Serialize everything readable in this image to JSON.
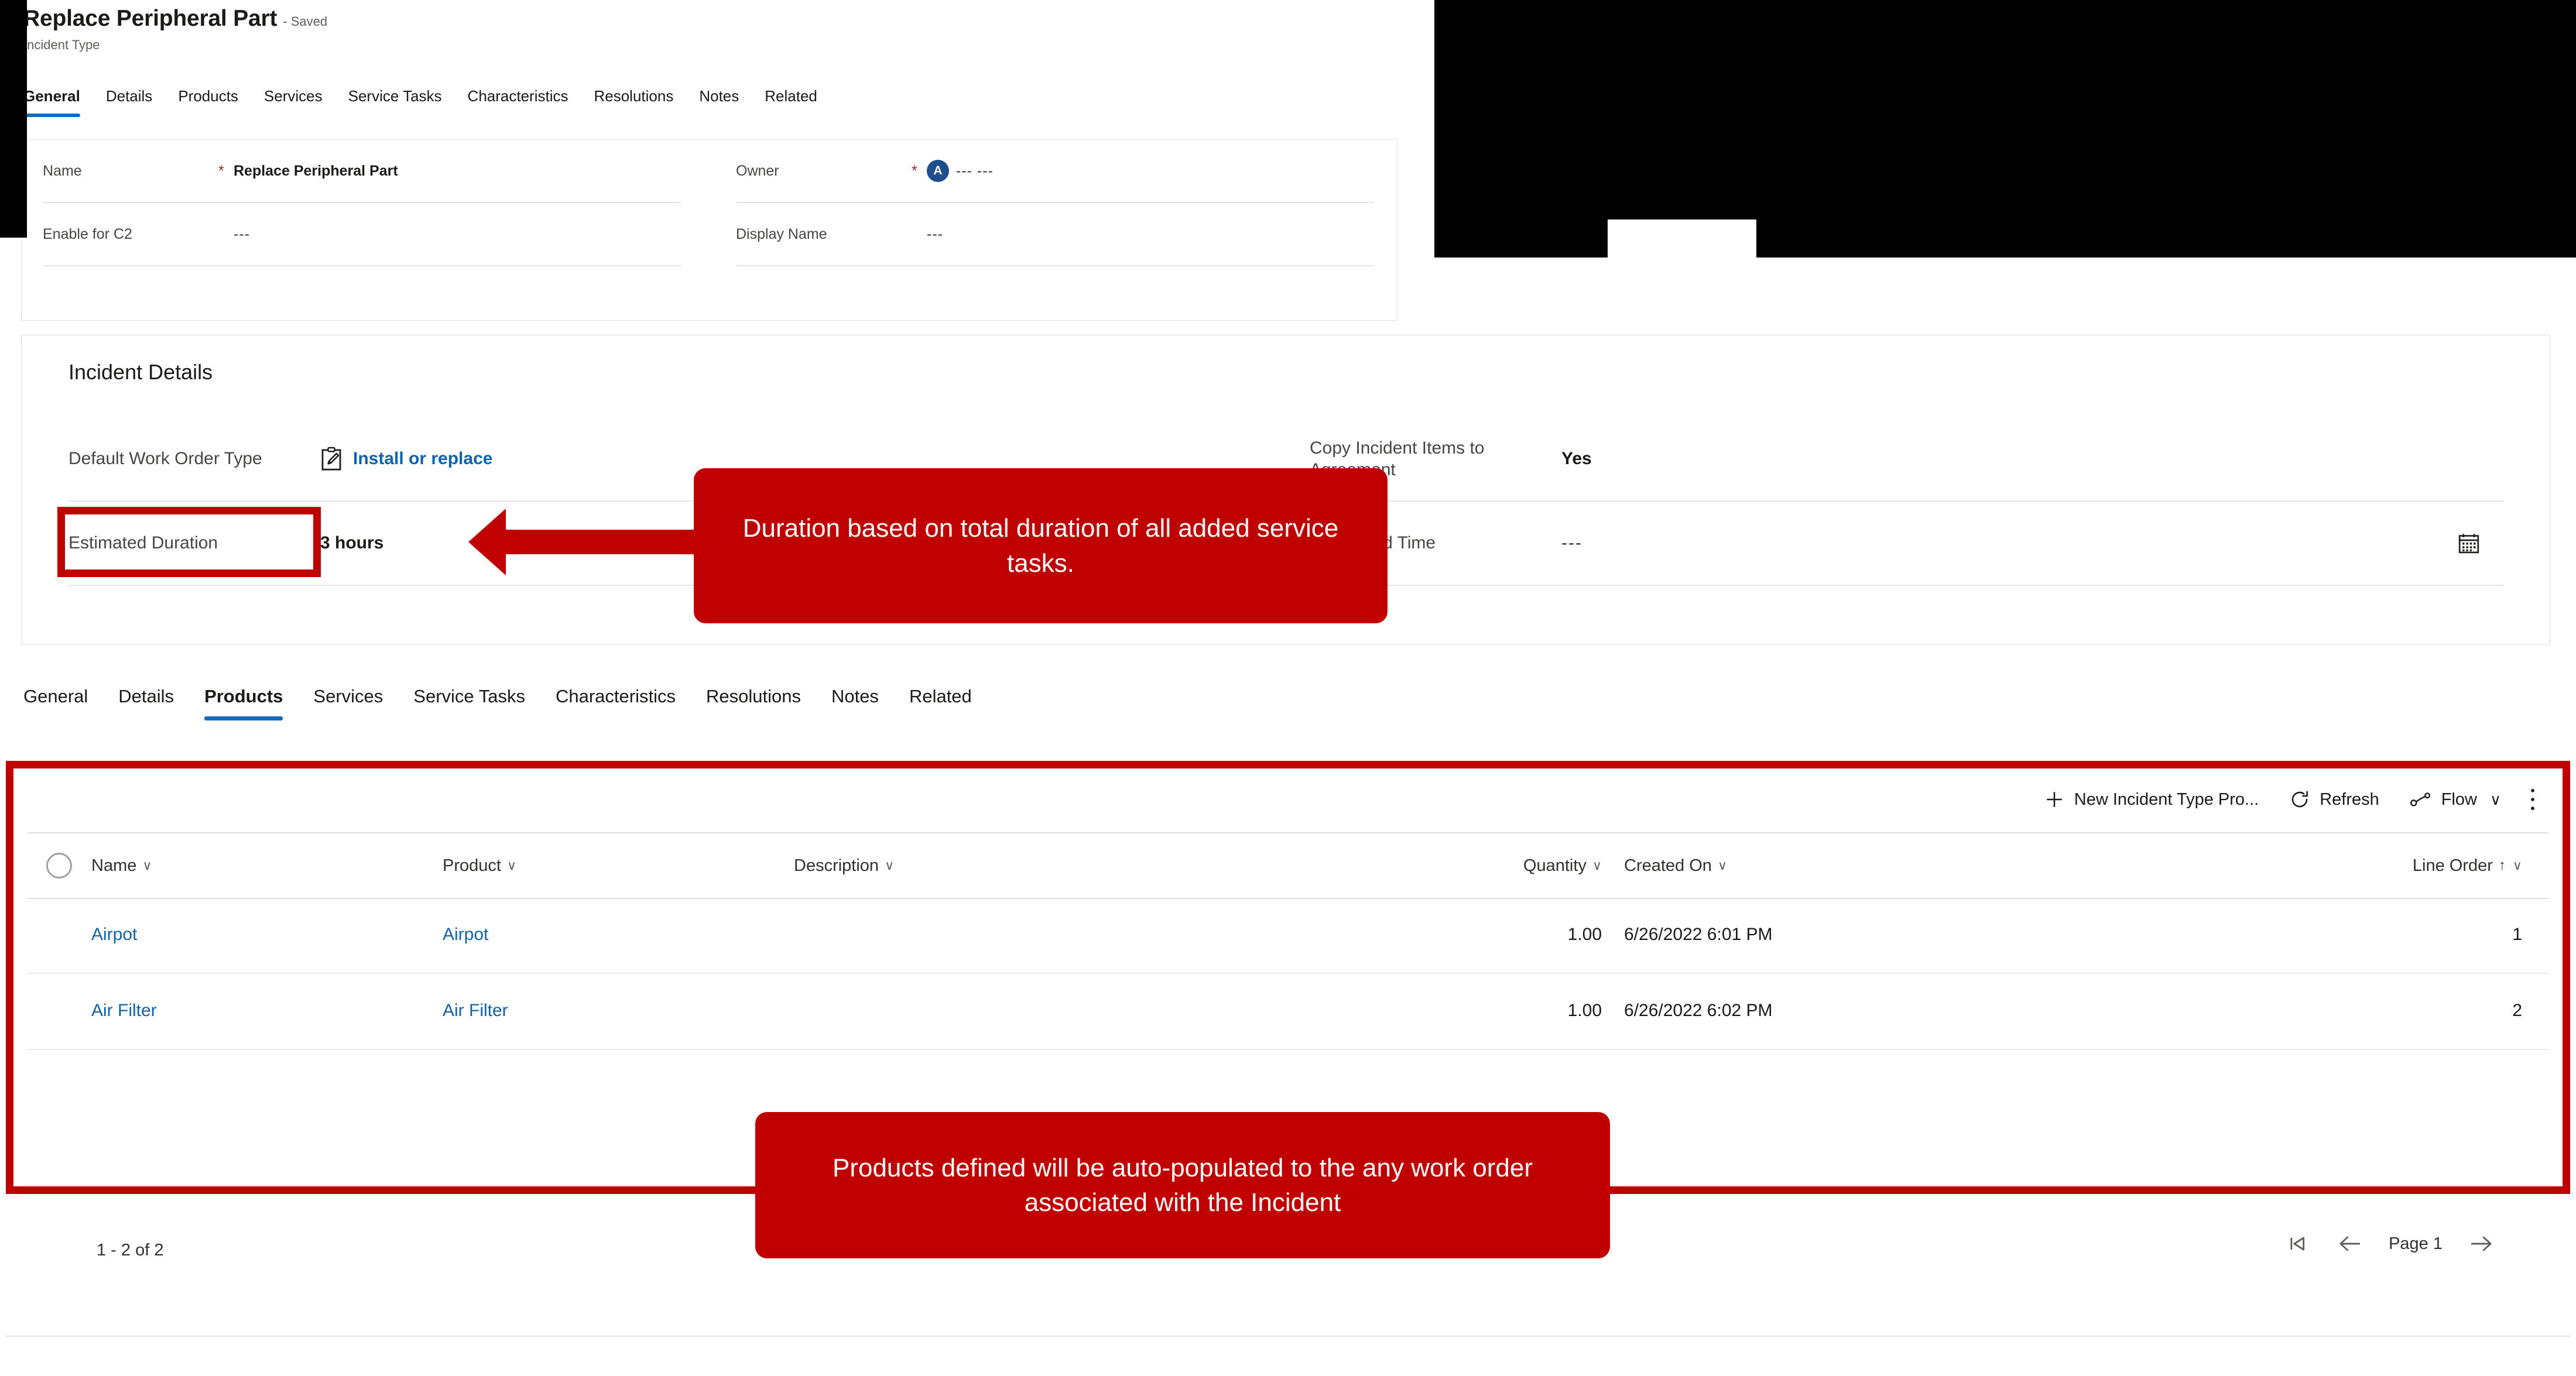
{
  "record": {
    "title": "Replace Peripheral Part",
    "saved_status": "- Saved",
    "entity": "Incident Type"
  },
  "tabs_top": [
    {
      "label": "General",
      "selected": true
    },
    {
      "label": "Details",
      "selected": false
    },
    {
      "label": "Products",
      "selected": false
    },
    {
      "label": "Services",
      "selected": false
    },
    {
      "label": "Service Tasks",
      "selected": false
    },
    {
      "label": "Characteristics",
      "selected": false
    },
    {
      "label": "Resolutions",
      "selected": false
    },
    {
      "label": "Notes",
      "selected": false
    },
    {
      "label": "Related",
      "selected": false
    }
  ],
  "tabs_bottom": [
    {
      "label": "General",
      "selected": false
    },
    {
      "label": "Details",
      "selected": false
    },
    {
      "label": "Products",
      "selected": true
    },
    {
      "label": "Services",
      "selected": false
    },
    {
      "label": "Service Tasks",
      "selected": false
    },
    {
      "label": "Characteristics",
      "selected": false
    },
    {
      "label": "Resolutions",
      "selected": false
    },
    {
      "label": "Notes",
      "selected": false
    },
    {
      "label": "Related",
      "selected": false
    }
  ],
  "general_form": {
    "name": {
      "label": "Name",
      "required": "*",
      "value": "Replace Peripheral Part"
    },
    "owner": {
      "label": "Owner",
      "required": "*",
      "avatar_initial": "A",
      "value": "--- ---"
    },
    "enable_for_c2": {
      "label": "Enable for C2",
      "value": "---"
    },
    "display_name": {
      "label": "Display Name",
      "value": "---"
    }
  },
  "incident_details": {
    "heading": "Incident Details",
    "default_work_order_type": {
      "label": "Default Work Order Type",
      "value": "Install or replace",
      "icon": "clipboard-pencil-icon"
    },
    "estimated_duration": {
      "label": "Estimated Duration",
      "value": "3 hours"
    },
    "copy_incident_items": {
      "label": "Copy Incident Items to Agreement",
      "value": "Yes"
    },
    "calculated_time": {
      "label": "Calculated Time",
      "value": "---",
      "icon": "calendar-icon"
    }
  },
  "callouts": {
    "duration": "Duration based on total duration of all added service tasks.",
    "products": "Products defined will be auto-populated to the any work order associated with the Incident"
  },
  "grid": {
    "toolbar": [
      {
        "label": "New Incident Type Pro...",
        "icon": "plus-icon"
      },
      {
        "label": "Refresh",
        "icon": "refresh-icon"
      },
      {
        "label": "Flow",
        "icon": "flow-icon",
        "chevron": "∨"
      },
      {
        "label": "",
        "icon": "more-vertical-icon"
      }
    ],
    "columns": [
      {
        "label": "Name",
        "chevron": "∨"
      },
      {
        "label": "Product",
        "chevron": "∨"
      },
      {
        "label": "Description",
        "chevron": "∨"
      },
      {
        "label": "Quantity",
        "chevron": "∨"
      },
      {
        "label": "Created On",
        "chevron": "∨"
      },
      {
        "label": "Line Order",
        "chevron": "∨",
        "sort": "↑"
      }
    ],
    "rows": [
      {
        "name": "Airpot",
        "product": "Airpot",
        "description": "",
        "quantity": "1.00",
        "created_on": "6/26/2022 6:01 PM",
        "line_order": "1"
      },
      {
        "name": "Air Filter",
        "product": "Air Filter",
        "description": "",
        "quantity": "1.00",
        "created_on": "6/26/2022 6:02 PM",
        "line_order": "2"
      }
    ],
    "footer": {
      "row_count": "1 - 2 of 2",
      "page_label": "Page 1",
      "first_icon": "first-page-icon",
      "prev_icon": "previous-page-icon",
      "next_icon": "next-page-icon"
    }
  },
  "colors": {
    "accent": "#0f6cbd",
    "link": "#0f62b0",
    "callout_red": "#c00000",
    "required_red": "#a4262c"
  }
}
